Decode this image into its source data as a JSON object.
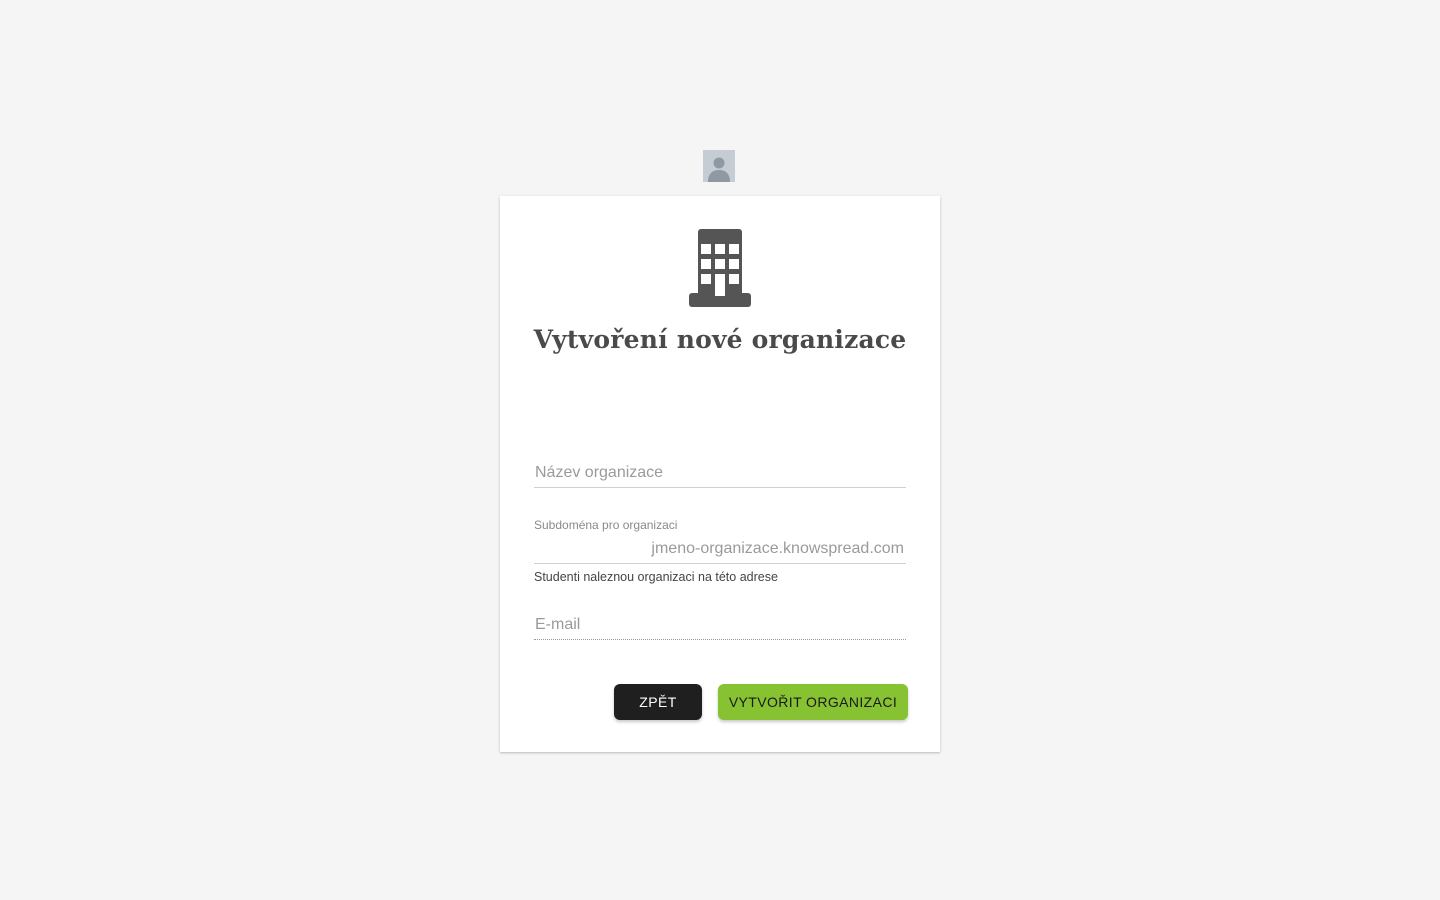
{
  "page": {
    "title": "Vytvoření nové organizace"
  },
  "form": {
    "name": {
      "placeholder": "Název organizace",
      "value": ""
    },
    "subdomain": {
      "label": "Subdoména pro organizaci",
      "placeholder": "jmeno-organizace.knowspread.com",
      "value": "",
      "hint": "Studenti naleznou organizaci na této adrese"
    },
    "email": {
      "placeholder": "E-mail",
      "value": ""
    }
  },
  "actions": {
    "back_label": "Zpět",
    "create_label": "Vytvořit organizaci"
  },
  "icons": {
    "avatar": "user-avatar-icon",
    "header": "building-icon"
  },
  "colors": {
    "primary_button": "#86c232",
    "secondary_button": "#1f1f1f",
    "background": "#f5f5f5"
  }
}
